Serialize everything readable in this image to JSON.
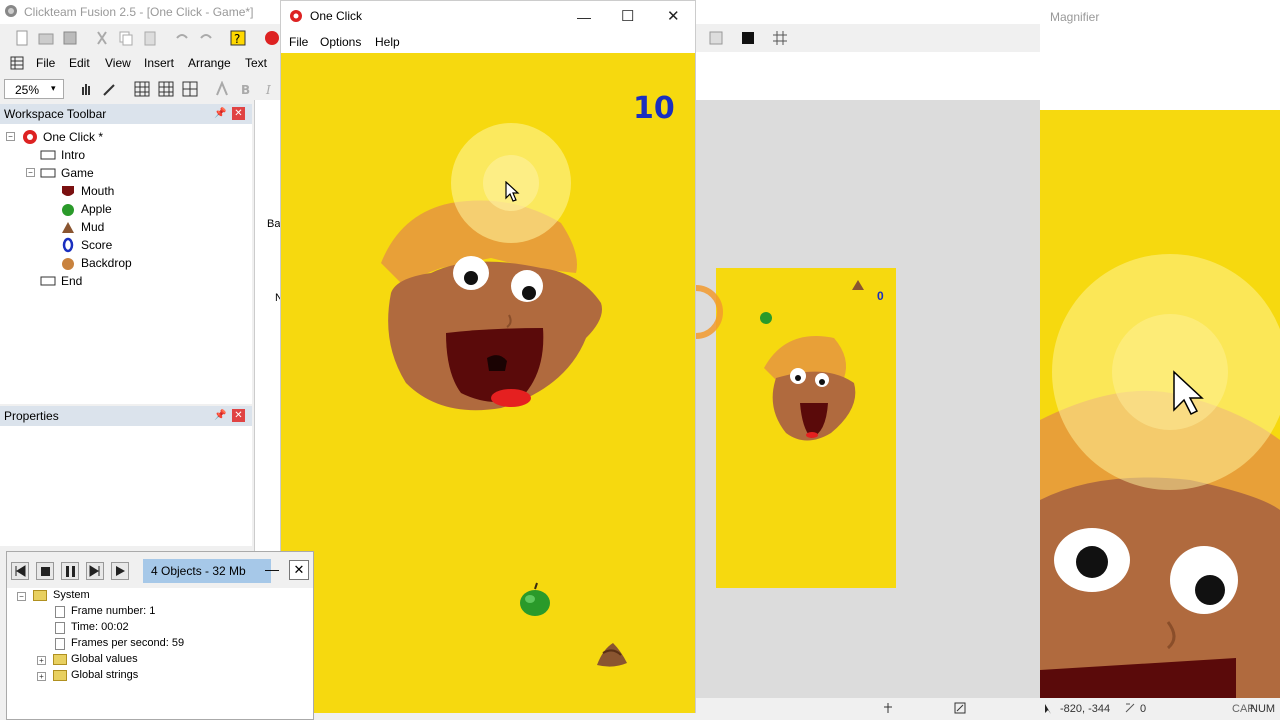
{
  "app": {
    "title": "Clickteam Fusion 2.5 - [One Click - Game*]",
    "menu": [
      "File",
      "Edit",
      "View",
      "Insert",
      "Arrange",
      "Text"
    ],
    "zoom": "25%"
  },
  "workspace": {
    "title": "Workspace Toolbar",
    "tree": {
      "root": "One Click *",
      "frames": [
        "Intro",
        "Game",
        "End"
      ],
      "objects": [
        "Mouth",
        "Apple",
        "Mud",
        "Score",
        "Backdrop"
      ]
    }
  },
  "properties": {
    "title": "Properties"
  },
  "debugger": {
    "info": "4 Objects - 32 Mb",
    "tree": {
      "system": "System",
      "frame_number": "Frame number: 1",
      "time": "Time: 00:02",
      "fps": "Frames per second: 59",
      "global_values": "Global values",
      "global_strings": "Global strings"
    }
  },
  "game": {
    "title": "One Click",
    "menu": [
      "File",
      "Options",
      "Help"
    ],
    "score": "10"
  },
  "editor": {
    "mini_score": "0",
    "side_labels": [
      "Ba",
      "N"
    ]
  },
  "magnifier": {
    "title": "Magnifier"
  },
  "status": {
    "coords": "-820, -344",
    "zero": "0",
    "cap": "CAP",
    "num": "NUM"
  },
  "colors": {
    "game_background": "#f6d90f",
    "score_color": "#1a2fbf",
    "selection": "#a6c8e8"
  }
}
